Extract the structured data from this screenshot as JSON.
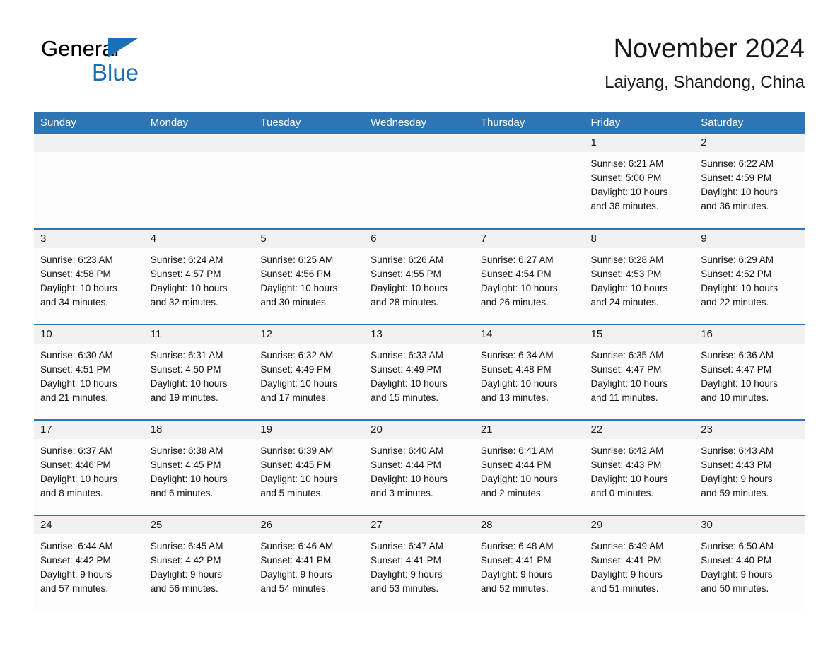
{
  "brand": {
    "word1": "General",
    "word2": "Blue",
    "triangle_color": "#1A70B8"
  },
  "header": {
    "month_title": "November 2024",
    "location": "Laiyang, Shandong, China"
  },
  "colors": {
    "header_blue": "#2E75B6",
    "row_divider_blue": "#2E75B6",
    "daynum_band": "#F1F1F1",
    "cell_background": "#FDFDFD",
    "text": "#111111"
  },
  "weekday_headers": [
    "Sunday",
    "Monday",
    "Tuesday",
    "Wednesday",
    "Thursday",
    "Friday",
    "Saturday"
  ],
  "weeks": [
    [
      {
        "day": "",
        "sunrise": "",
        "sunset": "",
        "daylight1": "",
        "daylight2": ""
      },
      {
        "day": "",
        "sunrise": "",
        "sunset": "",
        "daylight1": "",
        "daylight2": ""
      },
      {
        "day": "",
        "sunrise": "",
        "sunset": "",
        "daylight1": "",
        "daylight2": ""
      },
      {
        "day": "",
        "sunrise": "",
        "sunset": "",
        "daylight1": "",
        "daylight2": ""
      },
      {
        "day": "",
        "sunrise": "",
        "sunset": "",
        "daylight1": "",
        "daylight2": ""
      },
      {
        "day": "1",
        "sunrise": "Sunrise: 6:21 AM",
        "sunset": "Sunset: 5:00 PM",
        "daylight1": "Daylight: 10 hours",
        "daylight2": "and 38 minutes."
      },
      {
        "day": "2",
        "sunrise": "Sunrise: 6:22 AM",
        "sunset": "Sunset: 4:59 PM",
        "daylight1": "Daylight: 10 hours",
        "daylight2": "and 36 minutes."
      }
    ],
    [
      {
        "day": "3",
        "sunrise": "Sunrise: 6:23 AM",
        "sunset": "Sunset: 4:58 PM",
        "daylight1": "Daylight: 10 hours",
        "daylight2": "and 34 minutes."
      },
      {
        "day": "4",
        "sunrise": "Sunrise: 6:24 AM",
        "sunset": "Sunset: 4:57 PM",
        "daylight1": "Daylight: 10 hours",
        "daylight2": "and 32 minutes."
      },
      {
        "day": "5",
        "sunrise": "Sunrise: 6:25 AM",
        "sunset": "Sunset: 4:56 PM",
        "daylight1": "Daylight: 10 hours",
        "daylight2": "and 30 minutes."
      },
      {
        "day": "6",
        "sunrise": "Sunrise: 6:26 AM",
        "sunset": "Sunset: 4:55 PM",
        "daylight1": "Daylight: 10 hours",
        "daylight2": "and 28 minutes."
      },
      {
        "day": "7",
        "sunrise": "Sunrise: 6:27 AM",
        "sunset": "Sunset: 4:54 PM",
        "daylight1": "Daylight: 10 hours",
        "daylight2": "and 26 minutes."
      },
      {
        "day": "8",
        "sunrise": "Sunrise: 6:28 AM",
        "sunset": "Sunset: 4:53 PM",
        "daylight1": "Daylight: 10 hours",
        "daylight2": "and 24 minutes."
      },
      {
        "day": "9",
        "sunrise": "Sunrise: 6:29 AM",
        "sunset": "Sunset: 4:52 PM",
        "daylight1": "Daylight: 10 hours",
        "daylight2": "and 22 minutes."
      }
    ],
    [
      {
        "day": "10",
        "sunrise": "Sunrise: 6:30 AM",
        "sunset": "Sunset: 4:51 PM",
        "daylight1": "Daylight: 10 hours",
        "daylight2": "and 21 minutes."
      },
      {
        "day": "11",
        "sunrise": "Sunrise: 6:31 AM",
        "sunset": "Sunset: 4:50 PM",
        "daylight1": "Daylight: 10 hours",
        "daylight2": "and 19 minutes."
      },
      {
        "day": "12",
        "sunrise": "Sunrise: 6:32 AM",
        "sunset": "Sunset: 4:49 PM",
        "daylight1": "Daylight: 10 hours",
        "daylight2": "and 17 minutes."
      },
      {
        "day": "13",
        "sunrise": "Sunrise: 6:33 AM",
        "sunset": "Sunset: 4:49 PM",
        "daylight1": "Daylight: 10 hours",
        "daylight2": "and 15 minutes."
      },
      {
        "day": "14",
        "sunrise": "Sunrise: 6:34 AM",
        "sunset": "Sunset: 4:48 PM",
        "daylight1": "Daylight: 10 hours",
        "daylight2": "and 13 minutes."
      },
      {
        "day": "15",
        "sunrise": "Sunrise: 6:35 AM",
        "sunset": "Sunset: 4:47 PM",
        "daylight1": "Daylight: 10 hours",
        "daylight2": "and 11 minutes."
      },
      {
        "day": "16",
        "sunrise": "Sunrise: 6:36 AM",
        "sunset": "Sunset: 4:47 PM",
        "daylight1": "Daylight: 10 hours",
        "daylight2": "and 10 minutes."
      }
    ],
    [
      {
        "day": "17",
        "sunrise": "Sunrise: 6:37 AM",
        "sunset": "Sunset: 4:46 PM",
        "daylight1": "Daylight: 10 hours",
        "daylight2": "and 8 minutes."
      },
      {
        "day": "18",
        "sunrise": "Sunrise: 6:38 AM",
        "sunset": "Sunset: 4:45 PM",
        "daylight1": "Daylight: 10 hours",
        "daylight2": "and 6 minutes."
      },
      {
        "day": "19",
        "sunrise": "Sunrise: 6:39 AM",
        "sunset": "Sunset: 4:45 PM",
        "daylight1": "Daylight: 10 hours",
        "daylight2": "and 5 minutes."
      },
      {
        "day": "20",
        "sunrise": "Sunrise: 6:40 AM",
        "sunset": "Sunset: 4:44 PM",
        "daylight1": "Daylight: 10 hours",
        "daylight2": "and 3 minutes."
      },
      {
        "day": "21",
        "sunrise": "Sunrise: 6:41 AM",
        "sunset": "Sunset: 4:44 PM",
        "daylight1": "Daylight: 10 hours",
        "daylight2": "and 2 minutes."
      },
      {
        "day": "22",
        "sunrise": "Sunrise: 6:42 AM",
        "sunset": "Sunset: 4:43 PM",
        "daylight1": "Daylight: 10 hours",
        "daylight2": "and 0 minutes."
      },
      {
        "day": "23",
        "sunrise": "Sunrise: 6:43 AM",
        "sunset": "Sunset: 4:43 PM",
        "daylight1": "Daylight: 9 hours",
        "daylight2": "and 59 minutes."
      }
    ],
    [
      {
        "day": "24",
        "sunrise": "Sunrise: 6:44 AM",
        "sunset": "Sunset: 4:42 PM",
        "daylight1": "Daylight: 9 hours",
        "daylight2": "and 57 minutes."
      },
      {
        "day": "25",
        "sunrise": "Sunrise: 6:45 AM",
        "sunset": "Sunset: 4:42 PM",
        "daylight1": "Daylight: 9 hours",
        "daylight2": "and 56 minutes."
      },
      {
        "day": "26",
        "sunrise": "Sunrise: 6:46 AM",
        "sunset": "Sunset: 4:41 PM",
        "daylight1": "Daylight: 9 hours",
        "daylight2": "and 54 minutes."
      },
      {
        "day": "27",
        "sunrise": "Sunrise: 6:47 AM",
        "sunset": "Sunset: 4:41 PM",
        "daylight1": "Daylight: 9 hours",
        "daylight2": "and 53 minutes."
      },
      {
        "day": "28",
        "sunrise": "Sunrise: 6:48 AM",
        "sunset": "Sunset: 4:41 PM",
        "daylight1": "Daylight: 9 hours",
        "daylight2": "and 52 minutes."
      },
      {
        "day": "29",
        "sunrise": "Sunrise: 6:49 AM",
        "sunset": "Sunset: 4:41 PM",
        "daylight1": "Daylight: 9 hours",
        "daylight2": "and 51 minutes."
      },
      {
        "day": "30",
        "sunrise": "Sunrise: 6:50 AM",
        "sunset": "Sunset: 4:40 PM",
        "daylight1": "Daylight: 9 hours",
        "daylight2": "and 50 minutes."
      }
    ]
  ]
}
